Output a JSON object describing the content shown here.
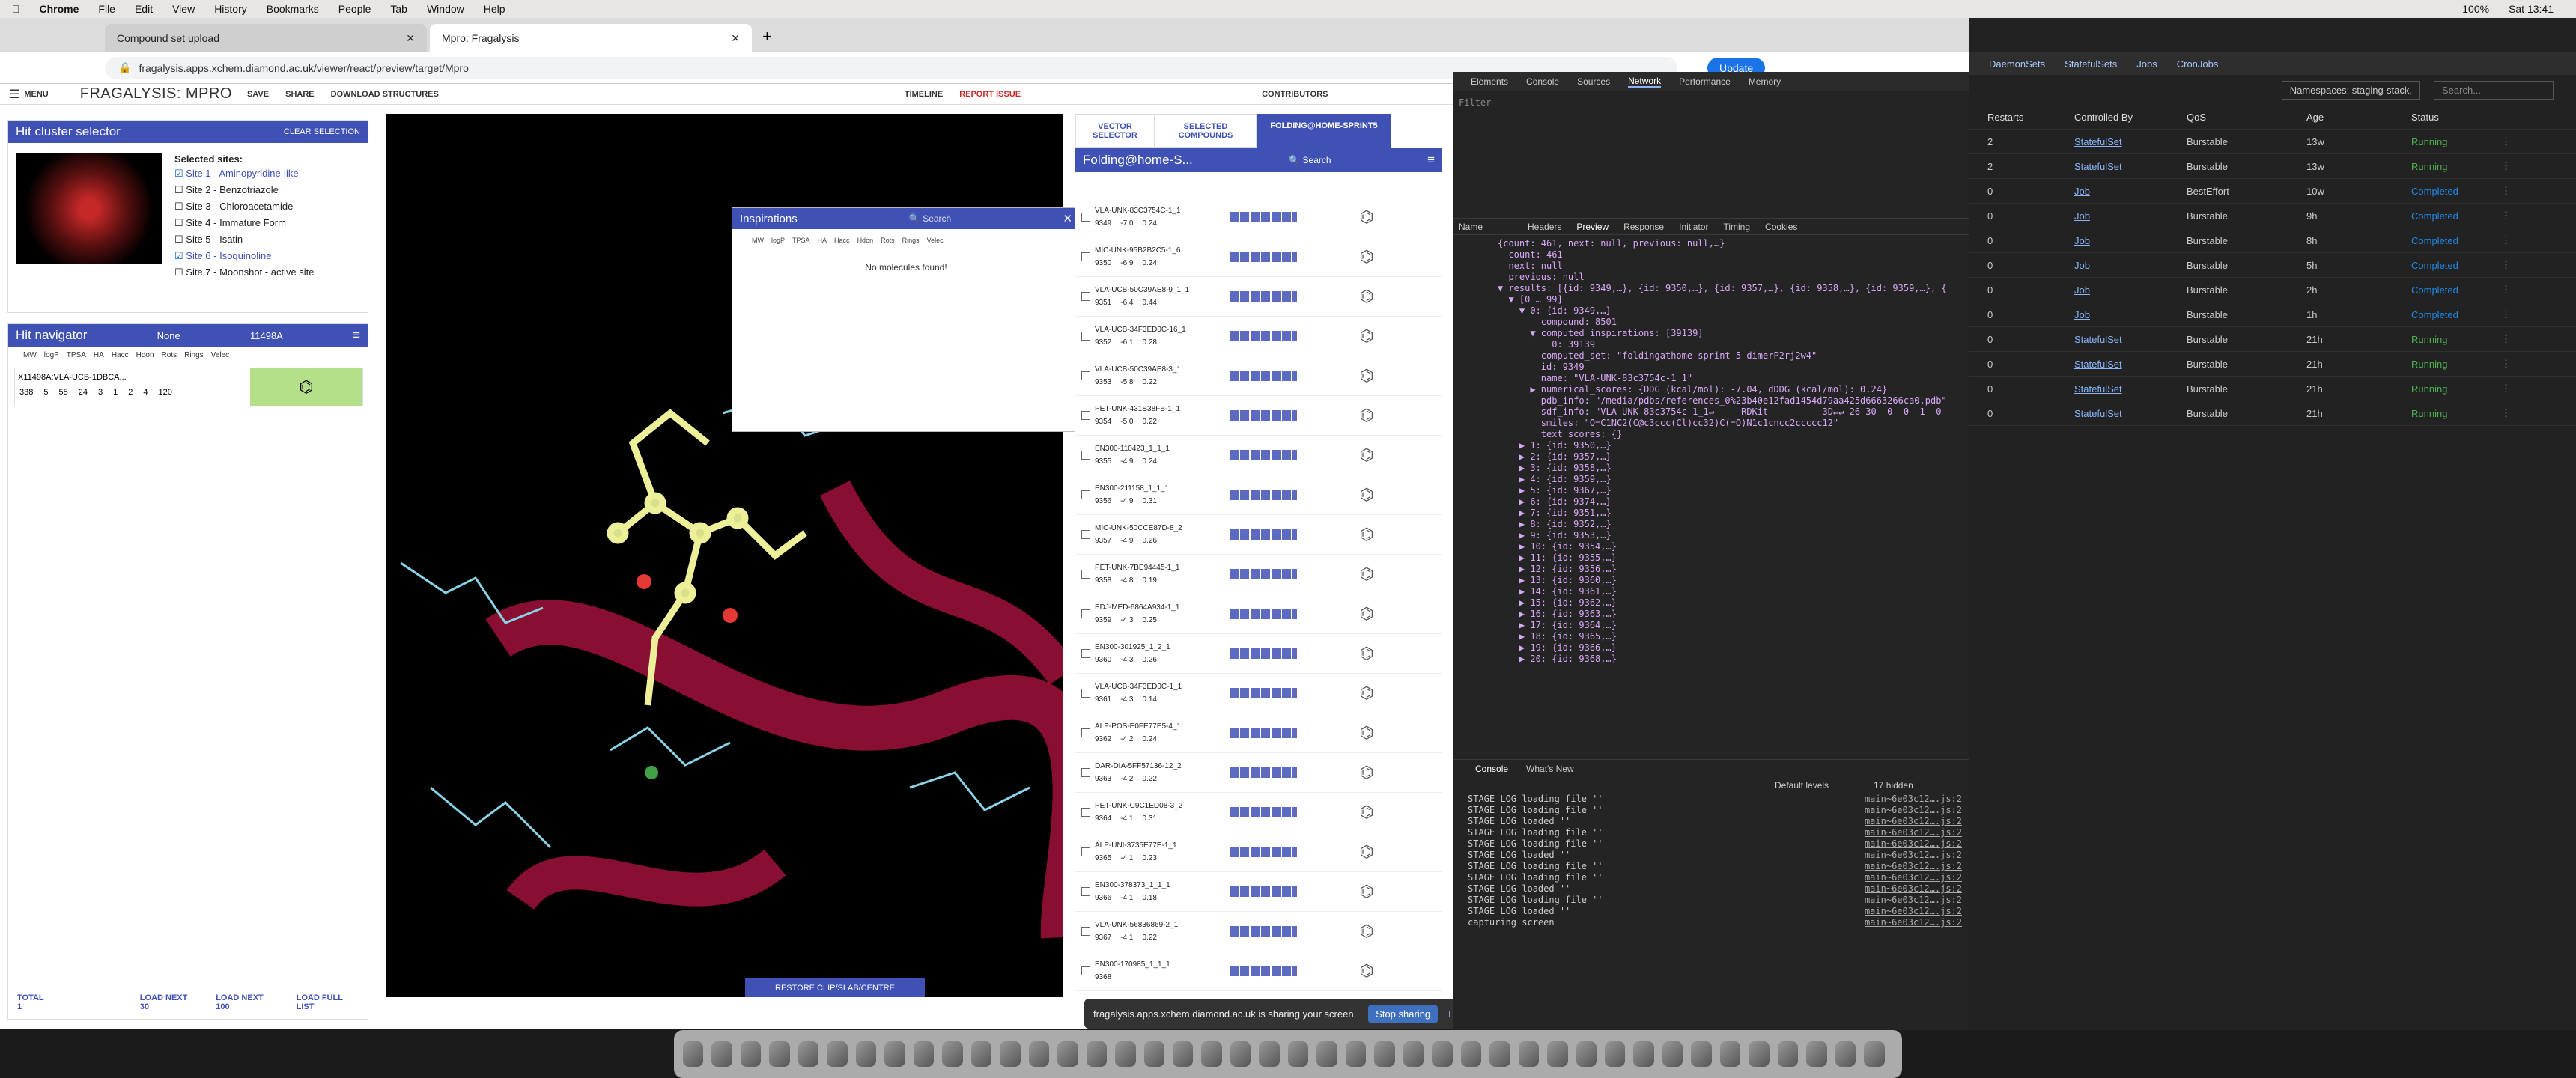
{
  "mac": {
    "menu": [
      "Chrome",
      "File",
      "Edit",
      "View",
      "History",
      "Bookmarks",
      "People",
      "Tab",
      "Window",
      "Help"
    ],
    "clock": "Sat 13:41",
    "battery": "100%"
  },
  "chrome": {
    "tabs": [
      {
        "label": "Compound set upload"
      },
      {
        "label": "Mpro: Fragalysis"
      }
    ],
    "url": "fragalysis.apps.xchem.diamond.ac.uk/viewer/react/preview/target/Mpro",
    "update_label": "Update"
  },
  "app": {
    "menu_label": "MENU",
    "brand": "FRAGALYSIS: MPRO",
    "save": "SAVE",
    "share": "SHARE",
    "download": "DOWNLOAD STRUCTURES",
    "timeline": "TIMELINE",
    "report": "REPORT ISSUE",
    "contributors": "CONTRIBUTORS"
  },
  "hit_cluster": {
    "title": "Hit cluster selector",
    "clear": "CLEAR SELECTION",
    "selected_label": "Selected sites:",
    "sites": [
      {
        "label": "Site 1 - Aminopyridine-like",
        "checked": true
      },
      {
        "label": "Site 2 - Benzotriazole",
        "checked": false
      },
      {
        "label": "Site 3 - Chloroacetamide",
        "checked": false
      },
      {
        "label": "Site 4 - Immature Form",
        "checked": false
      },
      {
        "label": "Site 5 - Isatin",
        "checked": false
      },
      {
        "label": "Site 6 - Isoquinoline",
        "checked": true
      },
      {
        "label": "Site 7 - Moonshot - active site",
        "checked": false
      }
    ]
  },
  "hit_nav": {
    "title": "Hit navigator",
    "filter": "None",
    "search": "11498A",
    "cols": [
      "MW",
      "logP",
      "TPSA",
      "HA",
      "Hacc",
      "Hdon",
      "Rots",
      "Rings",
      "Velec"
    ],
    "hit_name": "X11498A:VLA-UCB-1DBCA...",
    "hit_vals": [
      "338",
      "5",
      "55",
      "24",
      "3",
      "1",
      "2",
      "4",
      "120"
    ],
    "total": "TOTAL 1",
    "load30": "LOAD NEXT 30",
    "load100": "LOAD NEXT 100",
    "loadall": "LOAD FULL LIST"
  },
  "viewer": {
    "restore": "RESTORE CLIP/SLAB/CENTRE"
  },
  "inspirations": {
    "title": "Inspirations",
    "search_ph": "Search",
    "cols": [
      "MW",
      "logP",
      "TPSA",
      "HA",
      "Hacc",
      "Hdon",
      "Rots",
      "Rings",
      "Velec"
    ],
    "empty": "No molecules found!"
  },
  "right": {
    "tabs": [
      "VECTOR SELECTOR",
      "SELECTED COMPOUNDS",
      "FOLDING@HOME-SPRINT5"
    ],
    "header": "Folding@home-S...",
    "search_ph": "Search",
    "molecules": [
      {
        "name": "VLA-UNK-83C3754C-1_1",
        "id": "9349",
        "s1": "-7.0",
        "s2": "0.24"
      },
      {
        "name": "MIC-UNK-95B2B2C5-1_6",
        "id": "9350",
        "s1": "-6.9",
        "s2": "0.24"
      },
      {
        "name": "VLA-UCB-50C39AE8-9_1_1",
        "id": "9351",
        "s1": "-6.4",
        "s2": "0.44"
      },
      {
        "name": "VLA-UCB-34F3ED0C-16_1",
        "id": "9352",
        "s1": "-6.1",
        "s2": "0.28"
      },
      {
        "name": "VLA-UCB-50C39AE8-3_1",
        "id": "9353",
        "s1": "-5.8",
        "s2": "0.22"
      },
      {
        "name": "PET-UNK-431B38FB-1_1",
        "id": "9354",
        "s1": "-5.0",
        "s2": "0.22"
      },
      {
        "name": "EN300-110423_1_1_1",
        "id": "9355",
        "s1": "-4.9",
        "s2": "0.24"
      },
      {
        "name": "EN300-211158_1_1_1",
        "id": "9356",
        "s1": "-4.9",
        "s2": "0.31"
      },
      {
        "name": "MIC-UNK-50CCE87D-8_2",
        "id": "9357",
        "s1": "-4.9",
        "s2": "0.26"
      },
      {
        "name": "PET-UNK-7BE94445-1_1",
        "id": "9358",
        "s1": "-4.8",
        "s2": "0.19"
      },
      {
        "name": "EDJ-MED-6864A934-1_1",
        "id": "9359",
        "s1": "-4.3",
        "s2": "0.25"
      },
      {
        "name": "EN300-301925_1_2_1",
        "id": "9360",
        "s1": "-4.3",
        "s2": "0.26"
      },
      {
        "name": "VLA-UCB-34F3ED0C-1_1",
        "id": "9361",
        "s1": "-4.3",
        "s2": "0.14"
      },
      {
        "name": "ALP-POS-E0FE77E5-4_1",
        "id": "9362",
        "s1": "-4.2",
        "s2": "0.24"
      },
      {
        "name": "DAR-DIA-5FF57136-12_2",
        "id": "9363",
        "s1": "-4.2",
        "s2": "0.22"
      },
      {
        "name": "PET-UNK-C9C1ED08-3_2",
        "id": "9364",
        "s1": "-4.1",
        "s2": "0.31"
      },
      {
        "name": "ALP-UNI-3735E77E-1_1",
        "id": "9365",
        "s1": "-4.1",
        "s2": "0.23"
      },
      {
        "name": "EN300-378373_1_1_1",
        "id": "9366",
        "s1": "-4.1",
        "s2": "0.18"
      },
      {
        "name": "VLA-UNK-56836869-2_1",
        "id": "9367",
        "s1": "-4.1",
        "s2": "0.22"
      },
      {
        "name": "EN300-170985_1_1_1",
        "id": "9368",
        "s1": "",
        "s2": ""
      }
    ]
  },
  "devtools": {
    "tabs": [
      "Elements",
      "Console",
      "Sources",
      "Network",
      "Performance",
      "Memory"
    ],
    "filter_ph": "Filter",
    "detail_tabs": [
      "Name",
      "Headers",
      "Preview",
      "Response",
      "Initiator",
      "Timing",
      "Cookies"
    ],
    "preview": [
      "{count: 461, next: null, previous: null,…}",
      "  count: 461",
      "  next: null",
      "  previous: null",
      "▼ results: [{id: 9349,…}, {id: 9350,…}, {id: 9357,…}, {id: 9358,…}, {id: 9359,…}, {",
      "  ▼ [0 … 99]",
      "    ▼ 0: {id: 9349,…}",
      "        compound: 8501",
      "      ▼ computed_inspirations: [39139]",
      "          0: 39139",
      "        computed_set: \"foldingathome-sprint-5-dimerP2rj2w4\"",
      "        id: 9349",
      "        name: \"VLA-UNK-83c3754c-1_1\"",
      "      ▶ numerical_scores: {DDG (kcal/mol): -7.04, dDDG (kcal/mol): 0.24}",
      "        pdb_info: \"/media/pdbs/references_0%23b40e12fad1454d79aa425d6663266ca0.pdb\"",
      "        sdf_info: \"VLA-UNK-83c3754c-1_1↵     RDKit          3D↵↵ 26 30  0  0  1  0",
      "        smiles: \"O=C1NC2(C@c3ccc(Cl)cc32)C(=O)N1c1cncc2ccccc12\"",
      "        text_scores: {}",
      "    ▶ 1: {id: 9350,…}",
      "    ▶ 2: {id: 9357,…}",
      "    ▶ 3: {id: 9358,…}",
      "    ▶ 4: {id: 9359,…}",
      "    ▶ 5: {id: 9367,…}",
      "    ▶ 6: {id: 9374,…}",
      "    ▶ 7: {id: 9351,…}",
      "    ▶ 8: {id: 9352,…}",
      "    ▶ 9: {id: 9353,…}",
      "    ▶ 10: {id: 9354,…}",
      "    ▶ 11: {id: 9355,…}",
      "    ▶ 12: {id: 9356,…}",
      "    ▶ 13: {id: 9360,…}",
      "    ▶ 14: {id: 9361,…}",
      "    ▶ 15: {id: 9362,…}",
      "    ▶ 16: {id: 9363,…}",
      "    ▶ 17: {id: 9364,…}",
      "    ▶ 18: {id: 9365,…}",
      "    ▶ 19: {id: 9366,…}",
      "    ▶ 20: {id: 9368,…}"
    ],
    "console_tabs": [
      "Console",
      "What's New"
    ],
    "console_levels": "Default levels",
    "hidden": "17 hidden",
    "console": [
      "STAGE LOG loading file ''",
      "STAGE LOG loading file ''",
      "STAGE LOG loaded ''",
      "STAGE LOG loading file ''",
      "STAGE LOG loading file ''",
      "STAGE LOG loaded ''",
      "STAGE LOG loading file ''",
      "STAGE LOG loading file ''",
      "STAGE LOG loaded ''",
      "STAGE LOG loading file ''",
      "STAGE LOG loaded ''",
      "capturing screen"
    ],
    "src": "main~6e03c12….js:2"
  },
  "k8s": {
    "nav": [
      "DaemonSets",
      "StatefulSets",
      "Jobs",
      "CronJobs"
    ],
    "ns": "Namespaces: staging-stack,",
    "search_ph": "Search...",
    "cols": [
      "Restarts",
      "Controlled By",
      "QoS",
      "Age",
      "Status"
    ],
    "rows": [
      [
        "2",
        "StatefulSet",
        "Burstable",
        "13w",
        "Running"
      ],
      [
        "2",
        "StatefulSet",
        "Burstable",
        "13w",
        "Running"
      ],
      [
        "0",
        "Job",
        "BestEffort",
        "10w",
        "Completed"
      ],
      [
        "0",
        "Job",
        "Burstable",
        "9h",
        "Completed"
      ],
      [
        "0",
        "Job",
        "Burstable",
        "8h",
        "Completed"
      ],
      [
        "0",
        "Job",
        "Burstable",
        "5h",
        "Completed"
      ],
      [
        "0",
        "Job",
        "Burstable",
        "2h",
        "Completed"
      ],
      [
        "0",
        "Job",
        "Burstable",
        "1h",
        "Completed"
      ],
      [
        "0",
        "StatefulSet",
        "Burstable",
        "21h",
        "Running"
      ],
      [
        "0",
        "StatefulSet",
        "Burstable",
        "21h",
        "Running"
      ],
      [
        "0",
        "StatefulSet",
        "Burstable",
        "21h",
        "Running"
      ],
      [
        "0",
        "StatefulSet",
        "Burstable",
        "21h",
        "Running"
      ]
    ]
  },
  "sharebar": {
    "text": "fragalysis.apps.xchem.diamond.ac.uk is sharing your screen.",
    "stop": "Stop sharing",
    "hide": "Hide"
  }
}
